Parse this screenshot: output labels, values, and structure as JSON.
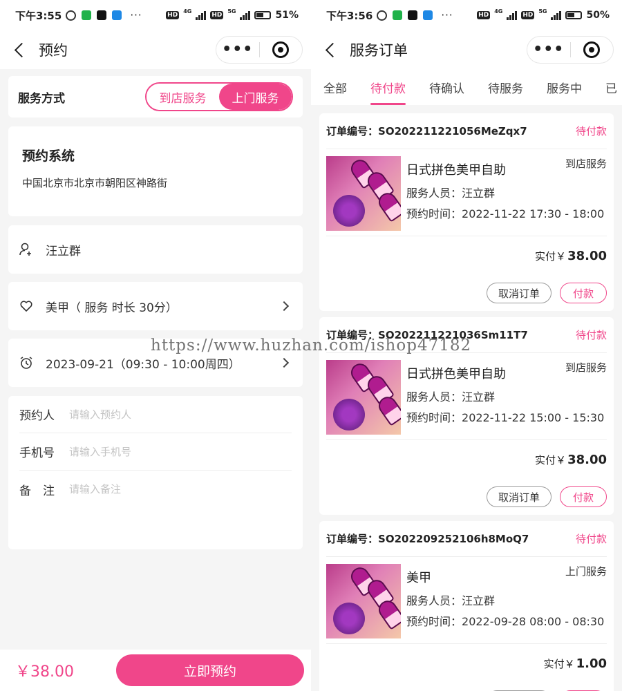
{
  "left": {
    "status": {
      "time": "下午3:55",
      "battery": "51%",
      "net1": "4G",
      "net2": "5G",
      "hd": "HD"
    },
    "nav": {
      "title": "预约",
      "more": "•••"
    },
    "service_mode": {
      "label": "服务方式",
      "options": [
        "到店服务",
        "上门服务"
      ],
      "selected": "上门服务"
    },
    "shop": {
      "name": "预约系统",
      "address": "中国北京市北京市朝阳区神路街"
    },
    "staff": "汪立群",
    "service": "美甲（ 服务 时长 30分）",
    "time": "2023-09-21（09:30 - 10:00周四）",
    "form": [
      {
        "label": "预约人",
        "placeholder": "请输入预约人"
      },
      {
        "label": "手机号",
        "placeholder": "请输入手机号"
      },
      {
        "label": "备　注",
        "placeholder": "请输入备注"
      }
    ],
    "footer": {
      "total": "￥38.00",
      "button": "立即预约"
    }
  },
  "right": {
    "status": {
      "time": "下午3:56",
      "battery": "50%",
      "net1": "4G",
      "net2": "5G",
      "hd": "HD"
    },
    "nav": {
      "title": "服务订单",
      "more": "•••"
    },
    "tabs": [
      "全部",
      "待付款",
      "待确认",
      "待服务",
      "服务中",
      "已"
    ],
    "active_tab": "待付款",
    "order_no_label": "订单编号：",
    "staff_label": "服务人员：",
    "time_label": "预约时间：",
    "paid_label": "实付￥",
    "cancel_label": "取消订单",
    "pay_label": "付款",
    "orders": [
      {
        "no": "SO202211221056MeZqx7",
        "status": "待付款",
        "name": "日式拼色美甲自助",
        "type": "到店服务",
        "staff": "汪立群",
        "time": "2022-11-22 17:30 - 18:00",
        "amount": "38.00"
      },
      {
        "no": "SO202211221036Sm11T7",
        "status": "待付款",
        "name": "日式拼色美甲自助",
        "type": "到店服务",
        "staff": "汪立群",
        "time": "2022-11-22 15:00 - 15:30",
        "amount": "38.00"
      },
      {
        "no": "SO202209252106h8MoQ7",
        "status": "待付款",
        "name": "美甲",
        "type": "上门服务",
        "staff": "汪立群",
        "time": "2022-09-28 08:00 - 08:30",
        "amount": "1.00"
      }
    ]
  },
  "watermark": "https://www.huzhan.com/ishop47182",
  "accent_color": "#f0468a"
}
